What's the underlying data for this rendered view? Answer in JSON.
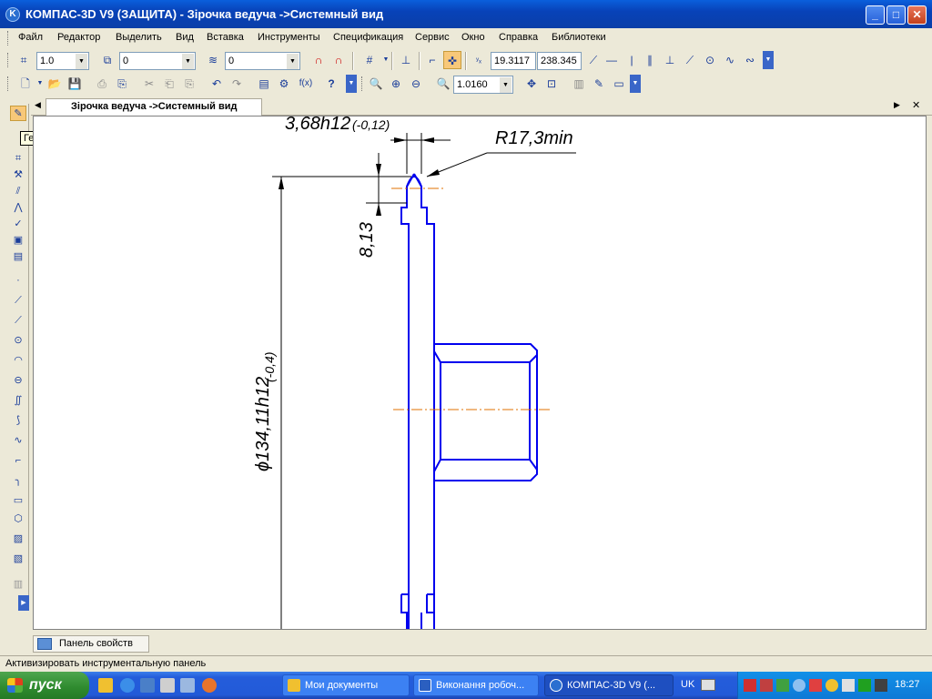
{
  "window": {
    "title": "КОМПАС-3D V9 (ЗАЩИТА) - Зірочка ведуча ->Системный вид",
    "app_icon_letter": "K",
    "minimize_glyph": "_",
    "maximize_glyph": "□",
    "close_glyph": "✕"
  },
  "menu": {
    "items": [
      "Файл",
      "Редактор",
      "Выделить",
      "Вид",
      "Вставка",
      "Инструменты",
      "Спецификация",
      "Сервис",
      "Окно",
      "Справка",
      "Библиотеки"
    ]
  },
  "toolbar1": {
    "line_scale": "1.0",
    "layer_field": "0",
    "style_field": "0",
    "coord_x": "19.3117",
    "coord_y": "238.345"
  },
  "toolbar2": {
    "zoom_value": "1.0160",
    "fx_label": "f(x)",
    "help_label": "?"
  },
  "tooltip": "Геометрия",
  "document_tab": {
    "label": "Зірочка ведуча ->Системный вид"
  },
  "drawing": {
    "dim_top_width": "3,68h12",
    "dim_top_tol": "(-0,12)",
    "radius_label": "R17,3min",
    "dim_813": "8,13",
    "diameter_label": "ϕ134,11h12",
    "diameter_tol": "(-0,4)"
  },
  "properties_panel": {
    "label": "Панель свойств"
  },
  "status_bar": {
    "text": "Активизировать инструментальную панель"
  },
  "taskbar": {
    "start_label": "пуск",
    "tasks": [
      "Мои документы",
      "Виконання робоч...",
      "КОМПАС-3D V9 (..."
    ],
    "language": "UK",
    "clock": "18:27"
  },
  "colors": {
    "drawing_line": "#0000ee",
    "axis_line": "#e07000",
    "dimension_line": "#000000"
  }
}
